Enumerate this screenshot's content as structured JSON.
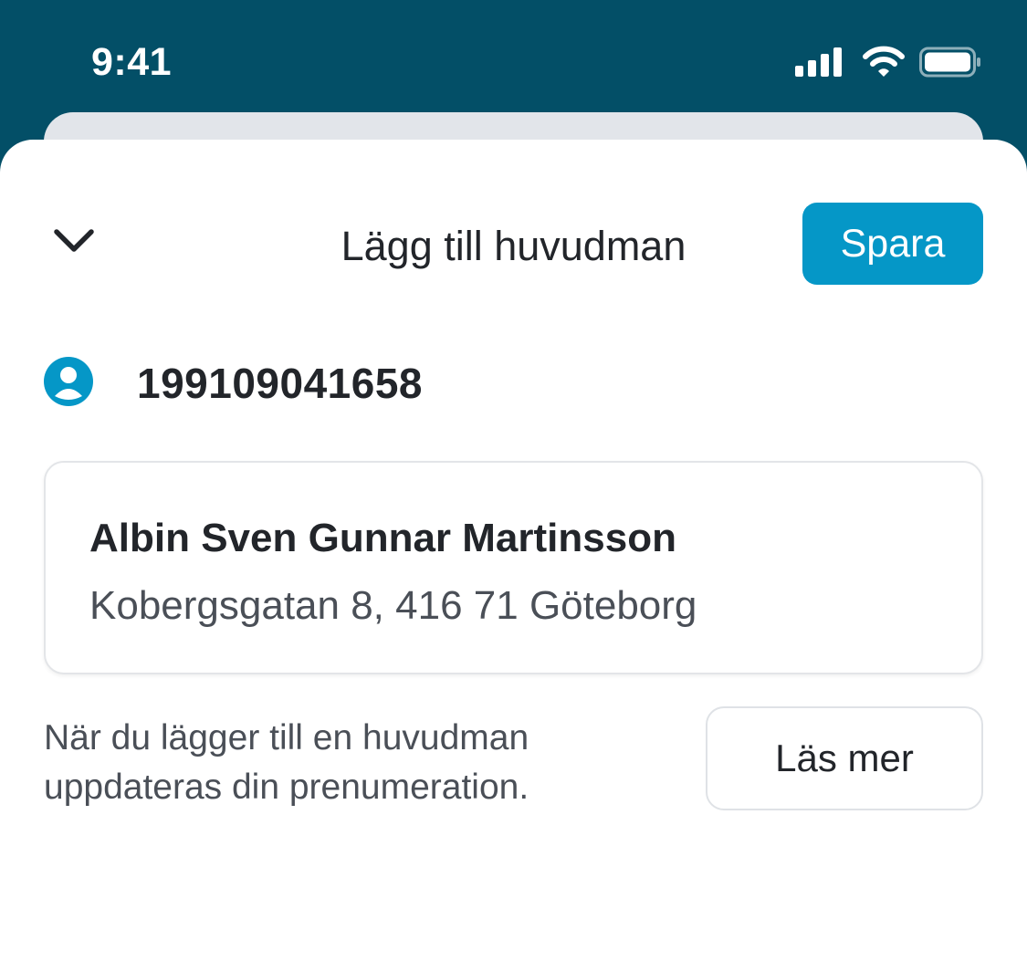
{
  "status_bar": {
    "time": "9:41",
    "icons": [
      "signal-icon",
      "wifi-icon",
      "battery-icon"
    ]
  },
  "header": {
    "collapse_icon": "chevron-down-icon",
    "title": "Lägg till huvudman",
    "save_label": "Spara"
  },
  "person": {
    "icon": "person-icon",
    "id_number": "199109041658",
    "name": "Albin Sven Gunnar Martinsson",
    "address": "Kobergsgatan 8, 416 71 Göteborg"
  },
  "info": {
    "text_line1": "När du lägger till en huvudman",
    "text_line2": "uppdateras din prenumeration.",
    "read_more_label": "Läs mer"
  },
  "colors": {
    "status_bar_bg": "#034f67",
    "accent": "#0597c7",
    "text_primary": "#22252a",
    "text_secondary": "#4a4f57",
    "back_sheet": "#e2e5ea"
  }
}
